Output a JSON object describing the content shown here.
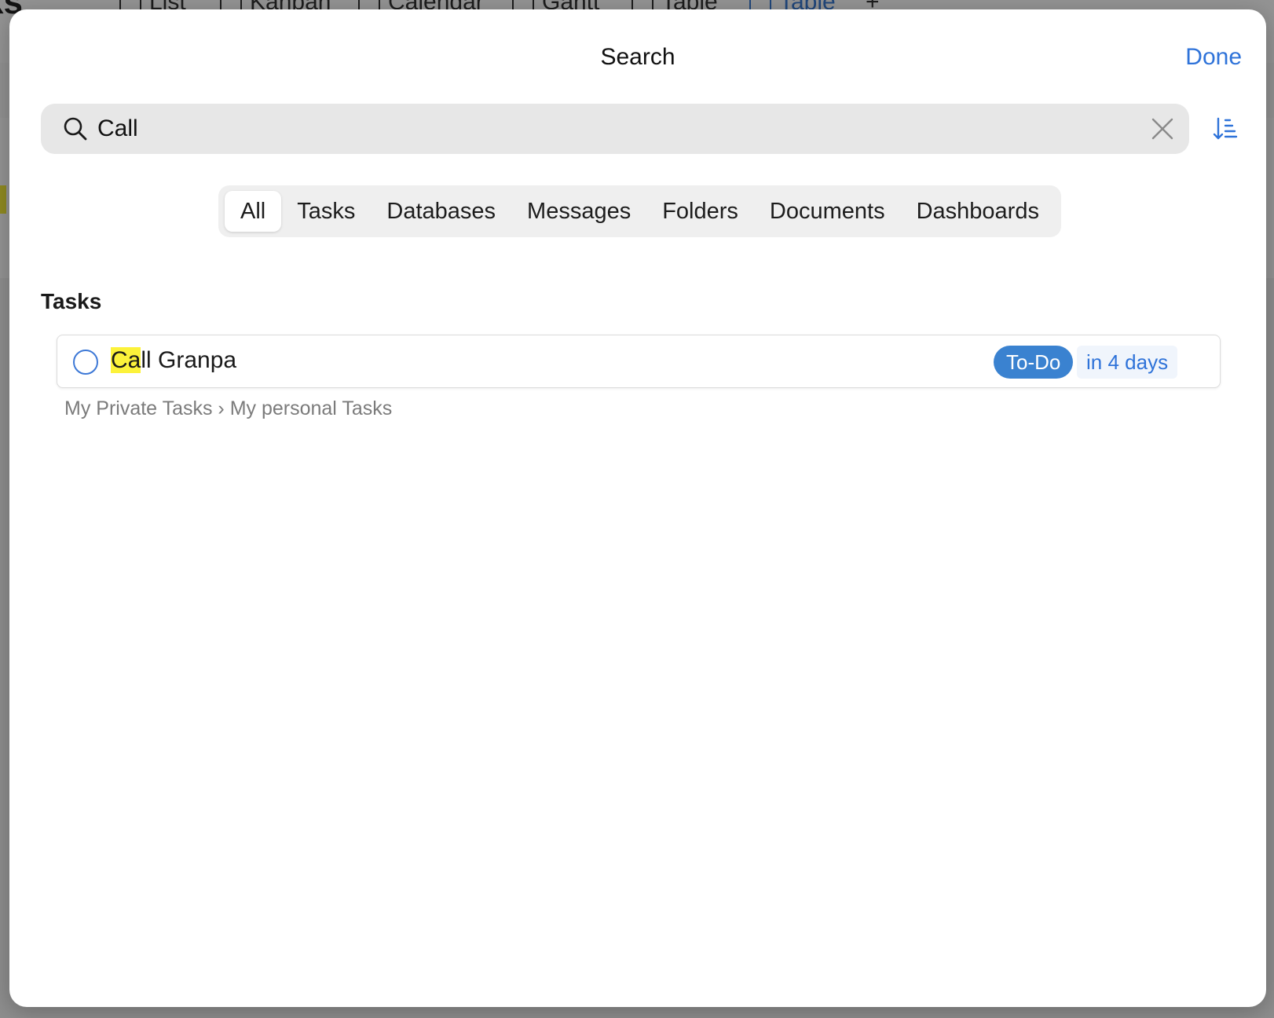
{
  "background": {
    "title": "ks",
    "tabs": [
      {
        "label": "List",
        "icon": "list-icon"
      },
      {
        "label": "Kanban",
        "icon": "kanban-icon"
      },
      {
        "label": "Calendar",
        "icon": "calendar-icon"
      },
      {
        "label": "Gantt",
        "icon": "gantt-icon"
      },
      {
        "label": "Table",
        "icon": "table-icon"
      },
      {
        "label": "Table",
        "icon": "table-icon",
        "active": true
      }
    ],
    "add_label": "+"
  },
  "modal": {
    "title": "Search",
    "done_label": "Done"
  },
  "search": {
    "value": "Call",
    "icon": "search-icon",
    "clear_icon": "close-icon",
    "sort_icon": "sort-icon"
  },
  "filters": {
    "selected": "All",
    "items": [
      "All",
      "Tasks",
      "Databases",
      "Messages",
      "Folders",
      "Documents",
      "Dashboards"
    ]
  },
  "results": {
    "section_title": "Tasks",
    "tasks": [
      {
        "title_match": "Ca",
        "title_rest": "ll Granpa",
        "status": "To-Do",
        "due": "in 4 days",
        "path": "My Private Tasks › My personal Tasks"
      }
    ]
  },
  "colors": {
    "accent": "#2f73d9",
    "status_badge": "#3a82d0",
    "highlight": "#fcf23a"
  }
}
